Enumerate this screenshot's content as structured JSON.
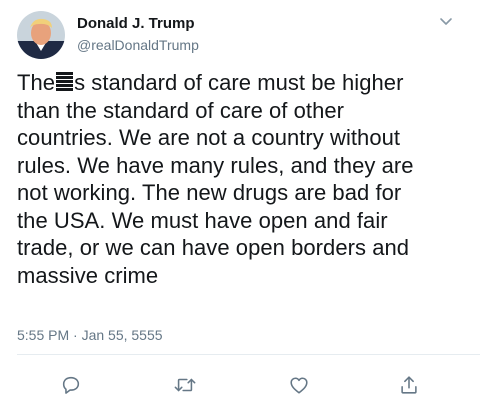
{
  "author": {
    "name": "Donald J. Trump",
    "handle": "@realDonaldTrump"
  },
  "tweet": {
    "lines": [
      {
        "before": "The",
        "redacted": true,
        "after": "s standard of care must be higher"
      },
      {
        "text": "than the standard of care of other"
      },
      {
        "text": "countries. We are not a country without"
      },
      {
        "text": "rules. We have many rules, and they are"
      },
      {
        "text": "not working. The new drugs are bad for"
      },
      {
        "text": "the USA. We must have open and fair"
      },
      {
        "text": "trade, or we can have open borders and"
      },
      {
        "text": "massive crime"
      }
    ],
    "timestamp": "5:55 PM · Jan 55, 5555"
  },
  "icons": {
    "menu": "chevron-down-icon",
    "reply": "reply-icon",
    "retweet": "retweet-icon",
    "like": "heart-icon",
    "share": "share-icon"
  },
  "colors": {
    "text": "#14171a",
    "secondary": "#657786",
    "divider": "#e6ecf0",
    "icon": "#657786"
  }
}
